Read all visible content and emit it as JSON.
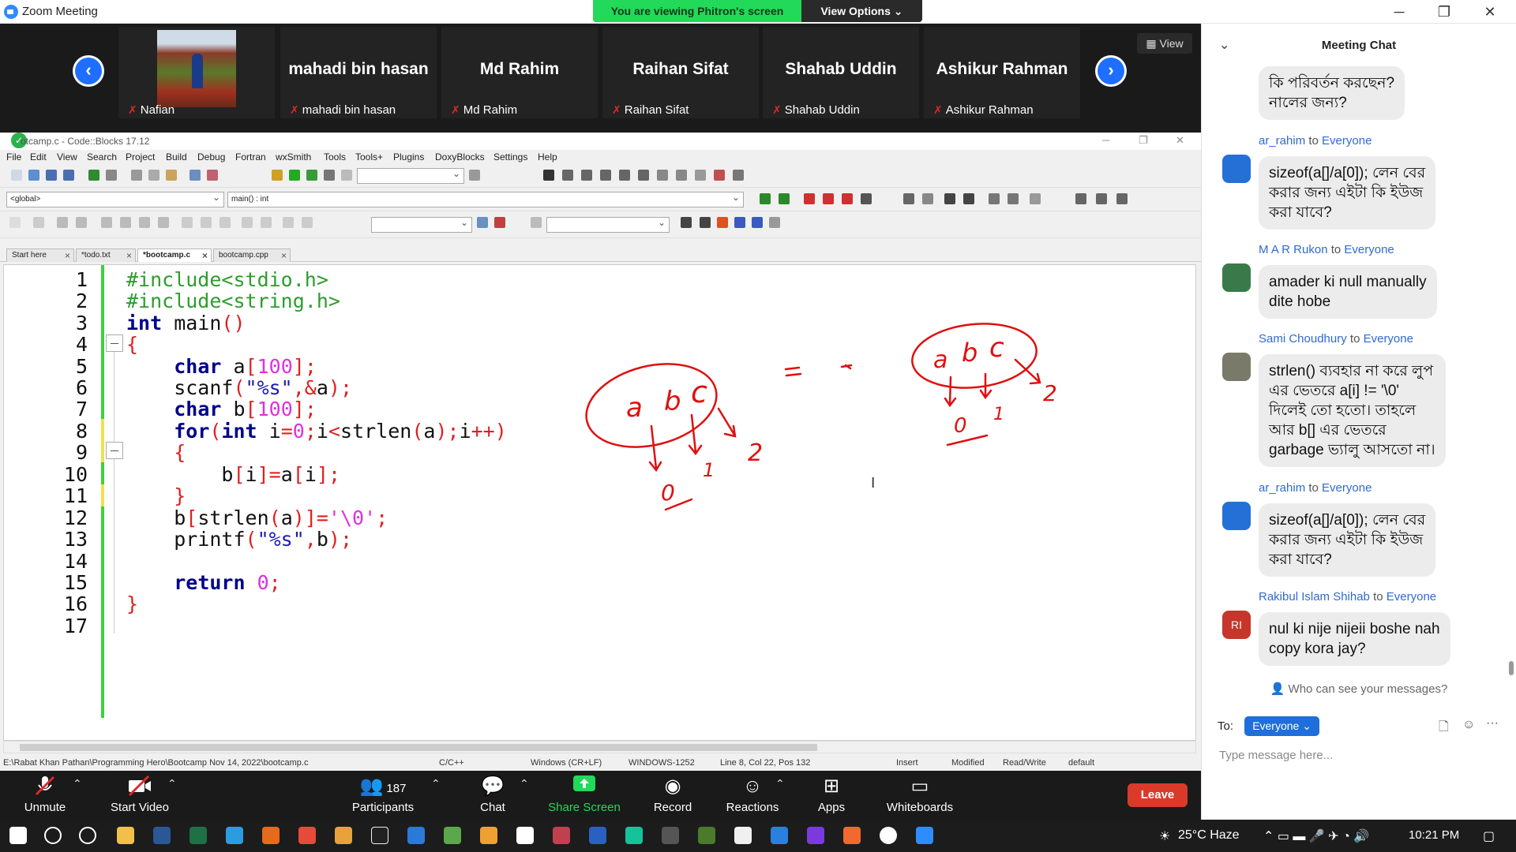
{
  "window": {
    "title": "Zoom Meeting"
  },
  "banner": {
    "viewing": "You are viewing Phitron's screen",
    "view_options": "View Options ⌄"
  },
  "gallery": {
    "view_label": "View",
    "tiles": [
      {
        "name": "",
        "label": "Nafian"
      },
      {
        "name": "mahadi bin hasan",
        "label": "mahadi bin hasan"
      },
      {
        "name": "Md Rahim",
        "label": "Md Rahim"
      },
      {
        "name": "Raihan Sifat",
        "label": "Raihan Sifat"
      },
      {
        "name": "Shahab Uddin",
        "label": "Shahab Uddin"
      },
      {
        "name": "Ashikur Rahman",
        "label": "Ashikur Rahman"
      }
    ]
  },
  "codeblocks": {
    "title": "otcamp.c - Code::Blocks 17.12",
    "menu": [
      "File",
      "Edit",
      "View",
      "Search",
      "Project",
      "Build",
      "Debug",
      "Fortran",
      "wxSmith",
      "Tools",
      "Tools+",
      "Plugins",
      "DoxyBlocks",
      "Settings",
      "Help"
    ],
    "scope_combo": "<global>",
    "func_combo": "main() : int",
    "tabs": [
      "Start here",
      "*todo.txt",
      "*bootcamp.c",
      "bootcamp.cpp"
    ],
    "line_numbers": [
      "1",
      "2",
      "3",
      "4",
      "5",
      "6",
      "7",
      "8",
      "9",
      "10",
      "11",
      "12",
      "13",
      "14",
      "15",
      "16",
      "17"
    ],
    "status": {
      "path": "E:\\Rabat Khan Pathan\\Programming Hero\\Bootcamp Nov 14, 2022\\bootcamp.c",
      "lang": "C/C++",
      "eol": "Windows (CR+LF)",
      "enc": "WINDOWS-1252",
      "pos": "Line 8, Col 22, Pos 132",
      "mode": "Insert",
      "modified": "Modified",
      "rw": "Read/Write",
      "def": "default"
    }
  },
  "annotation": {
    "chars": [
      "a",
      "b",
      "c",
      "a",
      "b",
      "c"
    ],
    "indices": [
      "0",
      "1",
      "2",
      "0",
      "1",
      "2"
    ],
    "equals": "="
  },
  "toolbar": {
    "unmute": "Unmute",
    "start_video": "Start Video",
    "participants": "Participants",
    "participants_count": "187",
    "chat": "Chat",
    "share": "Share Screen",
    "record": "Record",
    "reactions": "Reactions",
    "apps": "Apps",
    "whiteboards": "Whiteboards",
    "leave": "Leave"
  },
  "chat": {
    "header": "Meeting Chat",
    "top_bubble": "কি পরিবর্তন করছেন?\nনালের জন্য?",
    "to_word": "to",
    "messages": [
      {
        "sender": "ar_rahim",
        "to": "Everyone",
        "text": "sizeof(a[]/a[0]); লেন বের\nকরার জন্য এইটা কি ইউজ\nকরা যাবে?"
      },
      {
        "sender": "M A R Rukon",
        "to": "Everyone",
        "text": "amader ki null manually\ndite hobe"
      },
      {
        "sender": "Sami Choudhury",
        "to": "Everyone",
        "text": "strlen() ব্যবহার না করে লুপ\nএর ভেতরে a[i] != '\\0'\nদিলেই তো হতো। তাহলে\nআর b[] এর ভেতরে\ngarbage ভ্যালু আসতো না।"
      },
      {
        "sender": "ar_rahim",
        "to": "Everyone",
        "text": "sizeof(a[]/a[0]); লেন বের\nকরার জন্য এইটা কি ইউজ\nকরা যাবে?"
      },
      {
        "sender": "Rakibul Islam Shihab",
        "to": "Everyone",
        "text": "nul ki nije nijeii boshe nah\ncopy kora jay?",
        "initials": "RI"
      }
    ],
    "who_can_see": "Who can see your messages?",
    "to_label": "To:",
    "to_value": "Everyone ⌄",
    "input_placeholder": "Type message here..."
  },
  "taskbar": {
    "weather": "25°C  Haze",
    "time": "10:21 PM"
  }
}
